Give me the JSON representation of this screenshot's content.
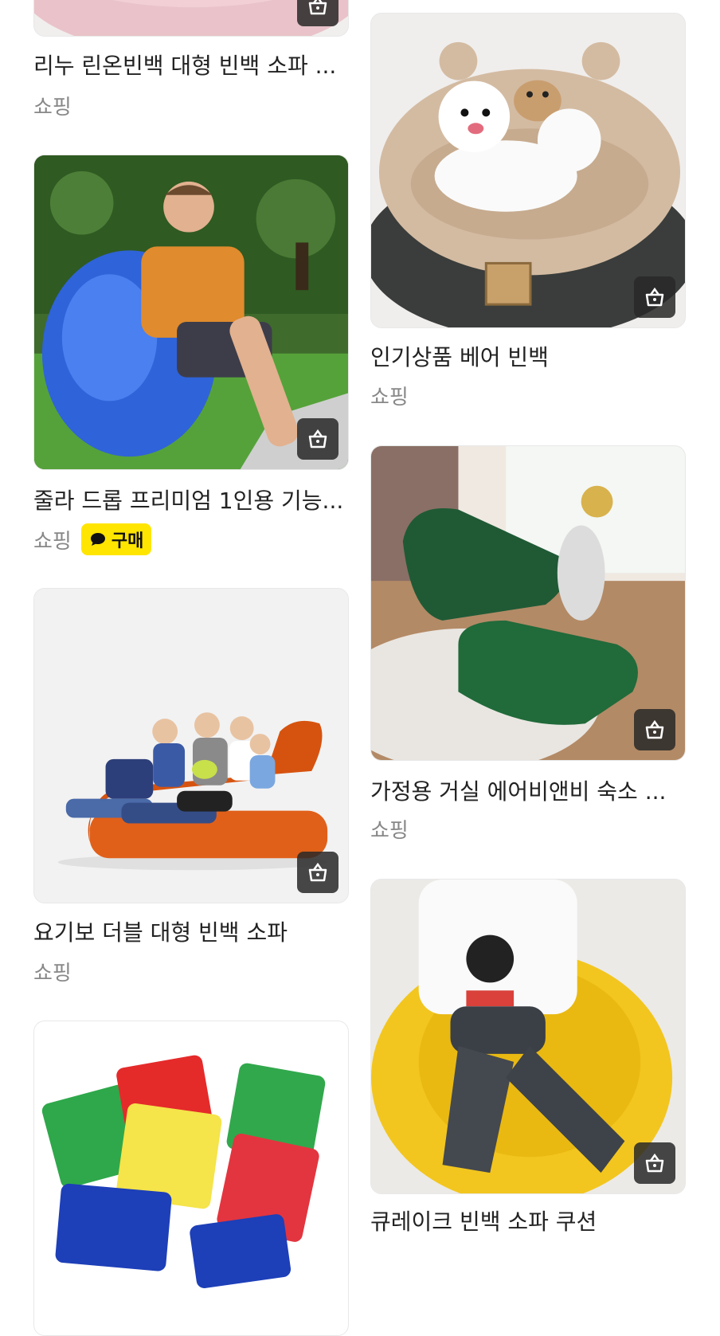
{
  "colors": {
    "buy_badge": "#ffe500",
    "shop_button_bg": "#2a2a2a",
    "source_text": "#888888"
  },
  "left_column": [
    {
      "title": "리누 린온빈백 대형 빈백 소파 ...",
      "source": "쇼핑",
      "badge": ""
    },
    {
      "title": "줄라 드롭 프리미엄 1인용 기능...",
      "source": "쇼핑",
      "badge": "구매"
    },
    {
      "title": "요기보 더블 대형 빈백 소파",
      "source": "쇼핑",
      "badge": ""
    },
    {
      "title": "",
      "source": "",
      "badge": ""
    }
  ],
  "right_column": [
    {
      "title": "인기상품 베어 빈백",
      "source": "쇼핑"
    },
    {
      "title": "가정용 거실 에어비앤비 숙소 ...",
      "source": "쇼핑"
    },
    {
      "title": "큐레이크 빈백 소파 쿠션",
      "source": "쇼핑"
    }
  ],
  "icons": {
    "shop_button": "shopping-bag-icon",
    "badge_icon": "speech-bubble-icon"
  }
}
